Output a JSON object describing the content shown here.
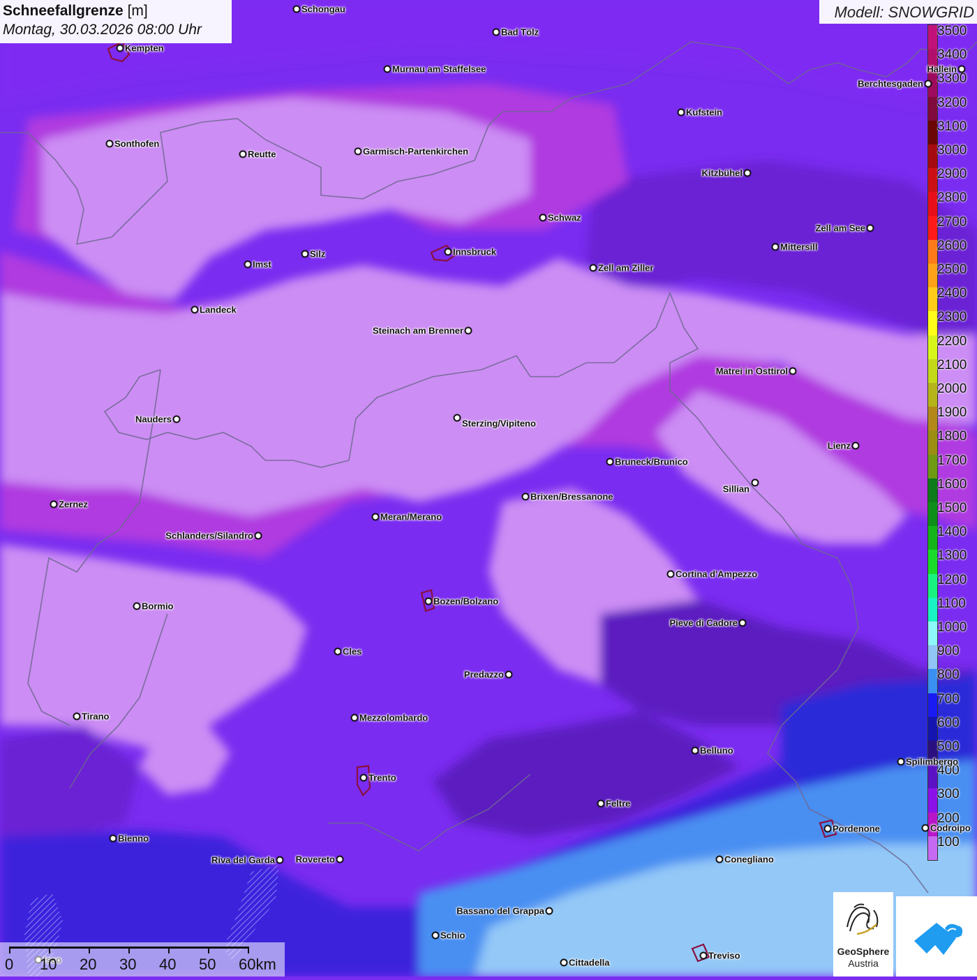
{
  "title": {
    "main": "Schneefallgrenze",
    "unit": "[m]",
    "datetime": "Montag, 30.03.2026 08:00 Uhr"
  },
  "model_label": "Modell: SNOWGRID",
  "legend": [
    {
      "value": "3500",
      "color": "#c2127a"
    },
    {
      "value": "3400",
      "color": "#b20f6c"
    },
    {
      "value": "3300",
      "color": "#9e0a5d"
    },
    {
      "value": "3200",
      "color": "#800a3c"
    },
    {
      "value": "3100",
      "color": "#6b0606"
    },
    {
      "value": "3000",
      "color": "#a50b10"
    },
    {
      "value": "2900",
      "color": "#cc1016"
    },
    {
      "value": "2800",
      "color": "#e80f1a"
    },
    {
      "value": "2700",
      "color": "#ff1a1a"
    },
    {
      "value": "2600",
      "color": "#ff7a1a"
    },
    {
      "value": "2500",
      "color": "#ffa21a"
    },
    {
      "value": "2400",
      "color": "#ffcc1a"
    },
    {
      "value": "2300",
      "color": "#ffff1a"
    },
    {
      "value": "2200",
      "color": "#d8f51a"
    },
    {
      "value": "2100",
      "color": "#c4d81a"
    },
    {
      "value": "2000",
      "color": "#b5b31a"
    },
    {
      "value": "1900",
      "color": "#b3881a"
    },
    {
      "value": "1800",
      "color": "#9c8e14"
    },
    {
      "value": "1700",
      "color": "#6e9a14"
    },
    {
      "value": "1600",
      "color": "#0f7a1a"
    },
    {
      "value": "1500",
      "color": "#0f8f1a"
    },
    {
      "value": "1400",
      "color": "#14b31a"
    },
    {
      "value": "1300",
      "color": "#1adb2a"
    },
    {
      "value": "1200",
      "color": "#1af280"
    },
    {
      "value": "1100",
      "color": "#1af2c2"
    },
    {
      "value": "1000",
      "color": "#8ef7f7"
    },
    {
      "value": "900",
      "color": "#8fc4f5"
    },
    {
      "value": "800",
      "color": "#3a8ff2"
    },
    {
      "value": "700",
      "color": "#1a1af2"
    },
    {
      "value": "600",
      "color": "#1414b0"
    },
    {
      "value": "500",
      "color": "#2a0f80"
    },
    {
      "value": "400",
      "color": "#5a12c4"
    },
    {
      "value": "300",
      "color": "#8a12e8"
    },
    {
      "value": "200",
      "color": "#b814c8"
    },
    {
      "value": "100",
      "color": "#c569f2"
    }
  ],
  "cities": [
    {
      "name": "Schongau"
    },
    {
      "name": "Bad Tölz"
    },
    {
      "name": "Kempten"
    },
    {
      "name": "Murnau am Staffelsee"
    },
    {
      "name": "Hallein"
    },
    {
      "name": "Berchtesgaden"
    },
    {
      "name": "Kufstein"
    },
    {
      "name": "Sonthofen"
    },
    {
      "name": "Reutte"
    },
    {
      "name": "Garmisch-Partenkirchen"
    },
    {
      "name": "Kitzbühel"
    },
    {
      "name": "Schwaz"
    },
    {
      "name": "Zell am See"
    },
    {
      "name": "Innsbruck"
    },
    {
      "name": "Mittersill"
    },
    {
      "name": "Silz"
    },
    {
      "name": "Imst"
    },
    {
      "name": "Zell am Ziller"
    },
    {
      "name": "Landeck"
    },
    {
      "name": "Steinach am Brenner"
    },
    {
      "name": "Matrei in Osttirol"
    },
    {
      "name": "Nauders"
    },
    {
      "name": "Sterzing/Vipiteno"
    },
    {
      "name": "Lienz"
    },
    {
      "name": "Bruneck/Brunico"
    },
    {
      "name": "Sillian"
    },
    {
      "name": "Brixen/Bressanone"
    },
    {
      "name": "Zernez"
    },
    {
      "name": "Meran/Merano"
    },
    {
      "name": "Schlanders/Silandro"
    },
    {
      "name": "Cortina d'Ampezzo"
    },
    {
      "name": "Bozen/Bolzano"
    },
    {
      "name": "Bormio"
    },
    {
      "name": "Pieve di Cadore"
    },
    {
      "name": "Cles"
    },
    {
      "name": "Predazzo"
    },
    {
      "name": "Tirano"
    },
    {
      "name": "Mezzolombardo"
    },
    {
      "name": "Belluno"
    },
    {
      "name": "Spilimbergo"
    },
    {
      "name": "Trento"
    },
    {
      "name": "Feltre"
    },
    {
      "name": "Pordenone"
    },
    {
      "name": "Codroipo"
    },
    {
      "name": "Bienno"
    },
    {
      "name": "Riva del Garda"
    },
    {
      "name": "Rovereto"
    },
    {
      "name": "Conegliano"
    },
    {
      "name": "Bassano del Grappa"
    },
    {
      "name": "Schio"
    },
    {
      "name": "Treviso"
    },
    {
      "name": "Cittadella"
    },
    {
      "name": "Iseo"
    }
  ],
  "scale": {
    "labels": [
      "0",
      "10",
      "20",
      "30",
      "40",
      "50",
      "60km"
    ]
  },
  "logos": {
    "geosphere_name": "GeoSphere",
    "geosphere_sub": "Austria"
  }
}
